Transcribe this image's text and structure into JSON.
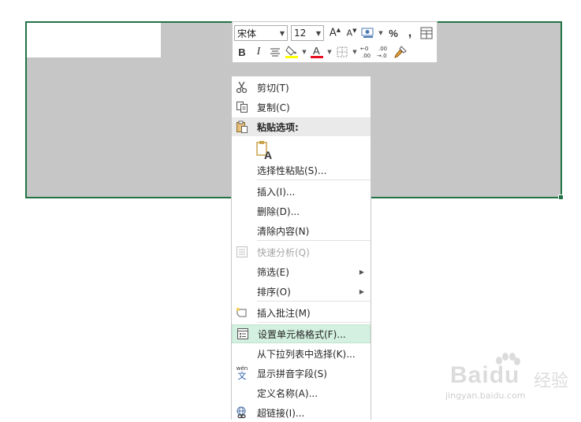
{
  "toolbar": {
    "font_name": "宋体",
    "font_size": "12",
    "percent_label": "%",
    "comma_label": ",",
    "bold_label": "B",
    "italic_label": "I",
    "font_color": "#e81123",
    "fill_color": "#ffff00",
    "increase_font_icon": "A^",
    "decrease_font_icon": "Aˇ",
    "inc_decimal_label": ".00",
    "dec_decimal_label": ".0"
  },
  "menu": {
    "items": [
      {
        "label": "剪切(T)",
        "icon": "scissors-icon"
      },
      {
        "label": "复制(C)",
        "icon": "copy-icon"
      },
      {
        "label": "粘贴选项:",
        "icon": "paste-icon"
      },
      {
        "label": "选择性粘贴(S)..."
      },
      {
        "label": "插入(I)..."
      },
      {
        "label": "删除(D)..."
      },
      {
        "label": "清除内容(N)"
      },
      {
        "label": "快速分析(Q)",
        "icon": "quick-analysis-icon",
        "disabled": true
      },
      {
        "label": "筛选(E)",
        "submenu": true
      },
      {
        "label": "排序(O)",
        "submenu": true
      },
      {
        "label": "插入批注(M)",
        "icon": "comment-icon"
      },
      {
        "label": "设置单元格格式(F)...",
        "icon": "format-cells-icon",
        "highlighted": true
      },
      {
        "label": "从下拉列表中选择(K)..."
      },
      {
        "label": "显示拼音字段(S)",
        "icon": "phonetic-icon"
      },
      {
        "label": "定义名称(A)..."
      },
      {
        "label": "超链接(I)...",
        "icon": "hyperlink-icon"
      }
    ],
    "paste_glyph": "A",
    "phonetic_glyph": "wén"
  },
  "watermark": {
    "brand": "Bai",
    "brand2": "du",
    "cn": "经验",
    "url": "jingyan.baidu.com"
  },
  "colors": {
    "selection_border": "#217346",
    "selection_fill": "#c6c6c6",
    "hover": "#d3f0e0"
  }
}
